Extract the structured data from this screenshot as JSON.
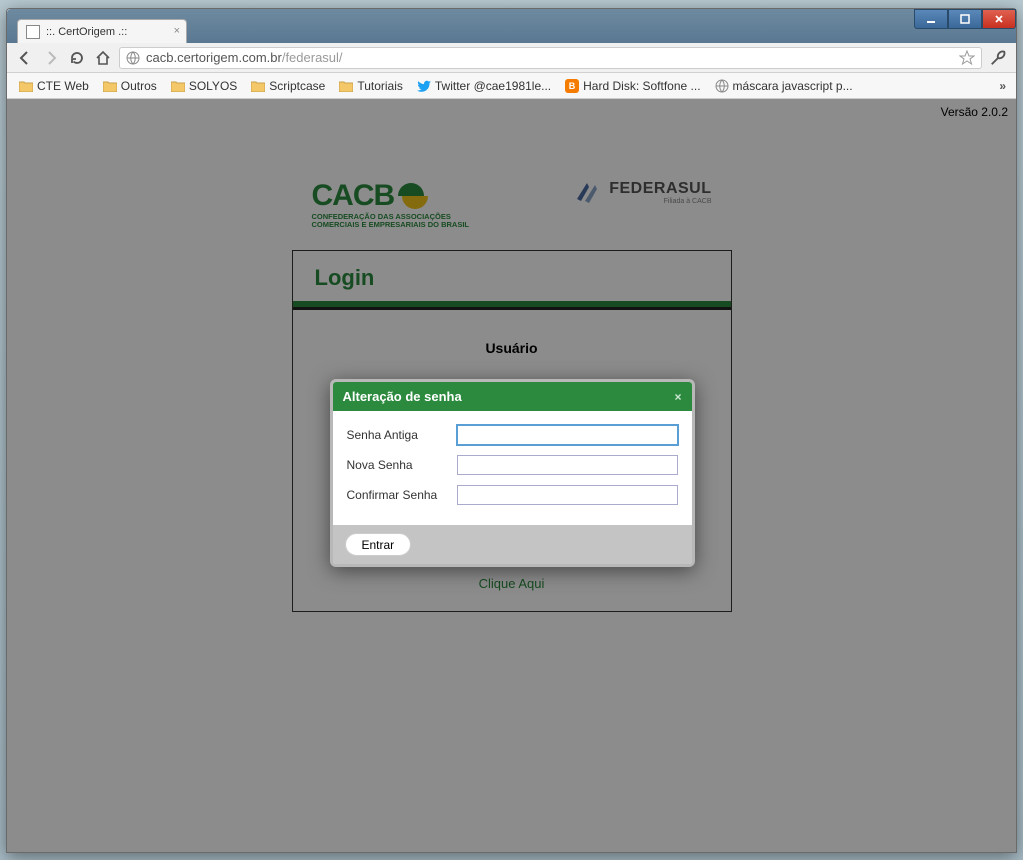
{
  "window": {
    "tab_title": "::. CertOrigem .::"
  },
  "addressbar": {
    "host": "cacb.certorigem.com.br",
    "path": "/federasul/"
  },
  "bookmarks": {
    "items": [
      {
        "label": "CTE Web",
        "icon": "folder"
      },
      {
        "label": "Outros",
        "icon": "folder"
      },
      {
        "label": "SOLYOS",
        "icon": "folder"
      },
      {
        "label": "Scriptcase",
        "icon": "folder"
      },
      {
        "label": "Tutoriais",
        "icon": "folder"
      },
      {
        "label": "Twitter @cae1981le...",
        "icon": "twitter"
      },
      {
        "label": "Hard Disk: Softfone ...",
        "icon": "blogger"
      },
      {
        "label": "máscara javascript p...",
        "icon": "globe"
      }
    ]
  },
  "page": {
    "version": "Versão 2.0.2",
    "logos": {
      "cacb_main": "CACB",
      "cacb_sub1": "CONFEDERAÇÃO DAS ASSOCIAÇÕES",
      "cacb_sub2": "COMERCIAIS E EMPRESARIAIS DO BRASIL",
      "federasul": "FEDERASUL",
      "federasul_sub": "Filiada à CACB"
    },
    "login": {
      "title": "Login",
      "usuario_label": "Usuário",
      "clique": "Clique Aqui"
    }
  },
  "modal": {
    "title": "Alteração de senha",
    "fields": {
      "senha_antiga": "Senha Antiga",
      "nova_senha": "Nova Senha",
      "confirmar_senha": "Confirmar Senha"
    },
    "submit": "Entrar"
  }
}
